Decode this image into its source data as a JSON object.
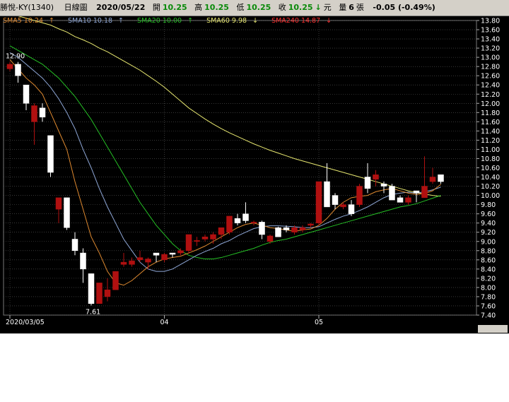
{
  "header": {
    "stock": "勝悅-KY(1340)",
    "period": "日線圖",
    "date": "2020/05/22",
    "open_label": "開",
    "open": "10.25",
    "high_label": "高",
    "high": "10.25",
    "low_label": "低",
    "low": "10.25",
    "close_label": "收",
    "close": "10.25",
    "arrow": "↓",
    "unit": "元",
    "volume_label": "量",
    "volume": "6",
    "volume_unit": "張",
    "change": "-0.05 (-0.49%)"
  },
  "legend": [
    {
      "text": "SMA5 10.24",
      "arrow": "↑",
      "color": "#e08a30"
    },
    {
      "text": "SMA10 10.18",
      "arrow": "↑",
      "color": "#8fa8d8"
    },
    {
      "text": "SMA20 10.00",
      "arrow": "↑",
      "color": "#25c025"
    },
    {
      "text": "SMA60 9.98",
      "arrow": "↓",
      "color": "#e8e870"
    },
    {
      "text": "SMA240 14.87",
      "arrow": "↓",
      "color": "#ff3030"
    }
  ],
  "colors": {
    "up": "#b01010",
    "down": "#ffffff",
    "grid": "#5a5a5a",
    "ma5": "#e08a30",
    "ma10": "#8fa8d8",
    "ma20": "#25c025",
    "ma60": "#e8e870"
  },
  "chart_data": {
    "type": "candlestick",
    "ylim": [
      7.4,
      13.8
    ],
    "y_ticks": [
      "13.80",
      "13.60",
      "13.40",
      "13.20",
      "13.00",
      "12.80",
      "12.60",
      "12.40",
      "12.20",
      "12.00",
      "11.80",
      "11.60",
      "11.40",
      "11.20",
      "11.00",
      "10.80",
      "10.60",
      "10.40",
      "10.20",
      "10.00",
      "9.80",
      "9.60",
      "9.40",
      "9.20",
      "9.00",
      "8.80",
      "8.60",
      "8.40",
      "8.20",
      "8.00",
      "7.80",
      "7.60",
      "7.40"
    ],
    "x_labels": [
      {
        "index": 0,
        "label": "2020/03/05"
      },
      {
        "index": 19,
        "label": "04"
      },
      {
        "index": 38,
        "label": "05"
      }
    ],
    "annotations": [
      {
        "text": "12.90",
        "index": 0,
        "value": 12.9
      },
      {
        "text": "7.61",
        "index": 10,
        "value": 7.61
      }
    ],
    "candles": [
      {
        "o": 12.75,
        "h": 12.9,
        "l": 12.7,
        "c": 12.85
      },
      {
        "o": 12.85,
        "h": 12.9,
        "l": 12.45,
        "c": 12.6
      },
      {
        "o": 12.4,
        "h": 12.4,
        "l": 11.85,
        "c": 12.0
      },
      {
        "o": 11.6,
        "h": 12.0,
        "l": 11.1,
        "c": 11.95
      },
      {
        "o": 11.9,
        "h": 12.0,
        "l": 11.6,
        "c": 11.7
      },
      {
        "o": 11.3,
        "h": 11.3,
        "l": 10.4,
        "c": 10.5
      },
      {
        "o": 9.7,
        "h": 9.95,
        "l": 9.4,
        "c": 9.95
      },
      {
        "o": 9.95,
        "h": 9.95,
        "l": 9.25,
        "c": 9.3
      },
      {
        "o": 9.05,
        "h": 9.2,
        "l": 8.7,
        "c": 8.8
      },
      {
        "o": 8.75,
        "h": 8.85,
        "l": 8.1,
        "c": 8.4
      },
      {
        "o": 8.3,
        "h": 8.3,
        "l": 7.61,
        "c": 7.65
      },
      {
        "o": 7.65,
        "h": 8.1,
        "l": 7.65,
        "c": 8.1
      },
      {
        "o": 7.8,
        "h": 8.2,
        "l": 7.7,
        "c": 7.95
      },
      {
        "o": 7.95,
        "h": 8.35,
        "l": 7.95,
        "c": 8.35
      },
      {
        "o": 8.5,
        "h": 8.75,
        "l": 8.45,
        "c": 8.55
      },
      {
        "o": 8.5,
        "h": 8.65,
        "l": 8.45,
        "c": 8.58
      },
      {
        "o": 8.6,
        "h": 8.8,
        "l": 8.55,
        "c": 8.65
      },
      {
        "o": 8.55,
        "h": 8.65,
        "l": 8.4,
        "c": 8.62
      },
      {
        "o": 8.75,
        "h": 8.75,
        "l": 8.55,
        "c": 8.7
      },
      {
        "o": 8.6,
        "h": 8.75,
        "l": 8.55,
        "c": 8.72
      },
      {
        "o": 8.75,
        "h": 8.75,
        "l": 8.65,
        "c": 8.72
      },
      {
        "o": 8.75,
        "h": 8.85,
        "l": 8.7,
        "c": 8.8
      },
      {
        "o": 8.8,
        "h": 9.15,
        "l": 8.75,
        "c": 9.15
      },
      {
        "o": 9.0,
        "h": 9.1,
        "l": 8.9,
        "c": 9.02
      },
      {
        "o": 9.05,
        "h": 9.15,
        "l": 9.0,
        "c": 9.1
      },
      {
        "o": 9.05,
        "h": 9.2,
        "l": 8.95,
        "c": 9.15
      },
      {
        "o": 9.15,
        "h": 9.3,
        "l": 9.05,
        "c": 9.3
      },
      {
        "o": 9.2,
        "h": 9.55,
        "l": 9.15,
        "c": 9.55
      },
      {
        "o": 9.5,
        "h": 9.6,
        "l": 9.35,
        "c": 9.4
      },
      {
        "o": 9.6,
        "h": 9.85,
        "l": 9.4,
        "c": 9.45
      },
      {
        "o": 9.4,
        "h": 9.45,
        "l": 9.35,
        "c": 9.42
      },
      {
        "o": 9.42,
        "h": 9.45,
        "l": 9.05,
        "c": 9.15
      },
      {
        "o": 9.0,
        "h": 9.15,
        "l": 8.95,
        "c": 9.12
      },
      {
        "o": 9.3,
        "h": 9.32,
        "l": 9.1,
        "c": 9.1
      },
      {
        "o": 9.3,
        "h": 9.35,
        "l": 9.2,
        "c": 9.25
      },
      {
        "o": 9.2,
        "h": 9.35,
        "l": 9.15,
        "c": 9.3
      },
      {
        "o": 9.25,
        "h": 9.35,
        "l": 9.2,
        "c": 9.3
      },
      {
        "o": 9.35,
        "h": 9.4,
        "l": 9.3,
        "c": 9.38
      },
      {
        "o": 9.4,
        "h": 10.3,
        "l": 9.35,
        "c": 10.3
      },
      {
        "o": 10.3,
        "h": 10.7,
        "l": 9.75,
        "c": 9.75
      },
      {
        "o": 10.0,
        "h": 10.05,
        "l": 9.7,
        "c": 9.8
      },
      {
        "o": 9.75,
        "h": 9.85,
        "l": 9.7,
        "c": 9.8
      },
      {
        "o": 9.8,
        "h": 9.9,
        "l": 9.55,
        "c": 9.6
      },
      {
        "o": 9.8,
        "h": 10.25,
        "l": 9.75,
        "c": 10.2
      },
      {
        "o": 10.4,
        "h": 10.7,
        "l": 10.05,
        "c": 10.15
      },
      {
        "o": 10.35,
        "h": 10.55,
        "l": 10.2,
        "c": 10.45
      },
      {
        "o": 10.25,
        "h": 10.3,
        "l": 10.05,
        "c": 10.2
      },
      {
        "o": 10.2,
        "h": 10.25,
        "l": 9.95,
        "c": 9.9
      },
      {
        "o": 9.95,
        "h": 10.0,
        "l": 9.85,
        "c": 9.85
      },
      {
        "o": 9.85,
        "h": 10.0,
        "l": 9.8,
        "c": 9.95
      },
      {
        "o": 10.1,
        "h": 10.1,
        "l": 9.85,
        "c": 10.05
      },
      {
        "o": 9.95,
        "h": 10.85,
        "l": 9.95,
        "c": 10.2
      },
      {
        "o": 10.3,
        "h": 10.6,
        "l": 10.25,
        "c": 10.4
      },
      {
        "o": 10.45,
        "h": 10.45,
        "l": 10.25,
        "c": 10.3
      }
    ],
    "sma5": [
      12.95,
      12.75,
      12.55,
      12.4,
      12.2,
      11.8,
      11.4,
      11.0,
      10.3,
      9.7,
      9.1,
      8.75,
      8.35,
      8.1,
      8.05,
      8.15,
      8.3,
      8.45,
      8.55,
      8.62,
      8.65,
      8.68,
      8.75,
      8.82,
      8.9,
      9.0,
      9.1,
      9.2,
      9.3,
      9.37,
      9.4,
      9.35,
      9.3,
      9.28,
      9.25,
      9.22,
      9.25,
      9.27,
      9.35,
      9.5,
      9.7,
      9.85,
      9.95,
      9.98,
      10.0,
      10.08,
      10.12,
      10.15,
      10.1,
      10.05,
      10.02,
      10.04,
      10.1,
      10.24
    ],
    "sma10": [
      13.1,
      13.0,
      12.85,
      12.7,
      12.55,
      12.35,
      12.1,
      11.8,
      11.45,
      11.0,
      10.6,
      10.15,
      9.75,
      9.4,
      9.05,
      8.8,
      8.55,
      8.4,
      8.35,
      8.35,
      8.4,
      8.5,
      8.6,
      8.7,
      8.78,
      8.85,
      8.95,
      9.02,
      9.12,
      9.2,
      9.28,
      9.32,
      9.34,
      9.34,
      9.33,
      9.32,
      9.3,
      9.3,
      9.32,
      9.4,
      9.48,
      9.55,
      9.6,
      9.67,
      9.75,
      9.85,
      9.95,
      10.02,
      10.05,
      10.07,
      10.05,
      10.08,
      10.12,
      10.18
    ],
    "sma20": [
      13.25,
      13.15,
      13.05,
      12.95,
      12.85,
      12.7,
      12.55,
      12.35,
      12.15,
      11.9,
      11.65,
      11.35,
      11.05,
      10.75,
      10.45,
      10.15,
      9.85,
      9.6,
      9.35,
      9.15,
      8.95,
      8.8,
      8.7,
      8.65,
      8.62,
      8.62,
      8.65,
      8.7,
      8.75,
      8.8,
      8.85,
      8.92,
      8.98,
      9.02,
      9.05,
      9.1,
      9.15,
      9.2,
      9.25,
      9.3,
      9.35,
      9.4,
      9.45,
      9.5,
      9.55,
      9.6,
      9.65,
      9.7,
      9.75,
      9.78,
      9.82,
      9.88,
      9.94,
      10.0
    ],
    "sma60": [
      13.95,
      13.9,
      13.85,
      13.8,
      13.75,
      13.7,
      13.62,
      13.55,
      13.45,
      13.38,
      13.3,
      13.2,
      13.12,
      13.02,
      12.92,
      12.82,
      12.72,
      12.6,
      12.48,
      12.35,
      12.2,
      12.05,
      11.9,
      11.78,
      11.66,
      11.55,
      11.45,
      11.36,
      11.28,
      11.2,
      11.12,
      11.05,
      10.98,
      10.92,
      10.86,
      10.8,
      10.75,
      10.7,
      10.65,
      10.6,
      10.55,
      10.5,
      10.45,
      10.4,
      10.35,
      10.3,
      10.25,
      10.2,
      10.15,
      10.1,
      10.06,
      10.03,
      10.0,
      9.98
    ]
  }
}
